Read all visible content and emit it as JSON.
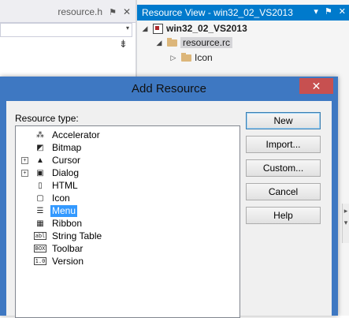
{
  "ide": {
    "doc_tab": {
      "filename": "resource.h",
      "pin_glyph": "⚑",
      "close_glyph": "✕"
    },
    "doc_nav_arrow": "▾",
    "split_glyph": "⇟",
    "resource_view": {
      "title": "Resource View - win32_02_VS2013",
      "controls": {
        "dropdown": "▾",
        "pin": "⚑",
        "close": "✕"
      },
      "tree": [
        {
          "label": "win32_02_VS2013",
          "expander": "◢"
        },
        {
          "label": "resource.rc",
          "expander": "◢"
        },
        {
          "label": "Icon",
          "expander": "▷"
        }
      ],
      "side_glyphs": [
        "▸",
        "▾"
      ]
    }
  },
  "dialog": {
    "title": "Add Resource",
    "close_glyph": "✕",
    "resource_type_label": "Resource type:",
    "resource_types": [
      {
        "label": "Accelerator",
        "icon": "accelerator-icon",
        "glyph": "⁂",
        "expandable": false,
        "selected": false
      },
      {
        "label": "Bitmap",
        "icon": "bitmap-icon",
        "glyph": "◩",
        "expandable": false,
        "selected": false
      },
      {
        "label": "Cursor",
        "icon": "cursor-icon",
        "glyph": "▲",
        "expandable": true,
        "selected": false
      },
      {
        "label": "Dialog",
        "icon": "dialog-icon",
        "glyph": "▣",
        "expandable": true,
        "selected": false
      },
      {
        "label": "HTML",
        "icon": "html-icon",
        "glyph": "▯",
        "expandable": false,
        "selected": false
      },
      {
        "label": "Icon",
        "icon": "icon-resource-icon",
        "glyph": "▢",
        "expandable": false,
        "selected": false
      },
      {
        "label": "Menu",
        "icon": "menu-icon",
        "glyph": "☰",
        "expandable": false,
        "selected": true
      },
      {
        "label": "Ribbon",
        "icon": "ribbon-icon",
        "glyph": "▦",
        "expandable": false,
        "selected": false
      },
      {
        "label": "String Table",
        "icon": "string-table-icon",
        "glyph": "abl",
        "expandable": false,
        "selected": false
      },
      {
        "label": "Toolbar",
        "icon": "toolbar-icon",
        "glyph": "BOX",
        "expandable": false,
        "selected": false
      },
      {
        "label": "Version",
        "icon": "version-icon",
        "glyph": "1.0",
        "expandable": false,
        "selected": false
      }
    ],
    "buttons": {
      "new": "New",
      "import": "Import...",
      "custom": "Custom...",
      "cancel": "Cancel",
      "help": "Help"
    },
    "expander_glyph": "+"
  },
  "colors": {
    "dialog_frame": "#3e78c2",
    "close_button": "#c75050",
    "vs_accent": "#007acc",
    "selection": "#3399ff"
  }
}
